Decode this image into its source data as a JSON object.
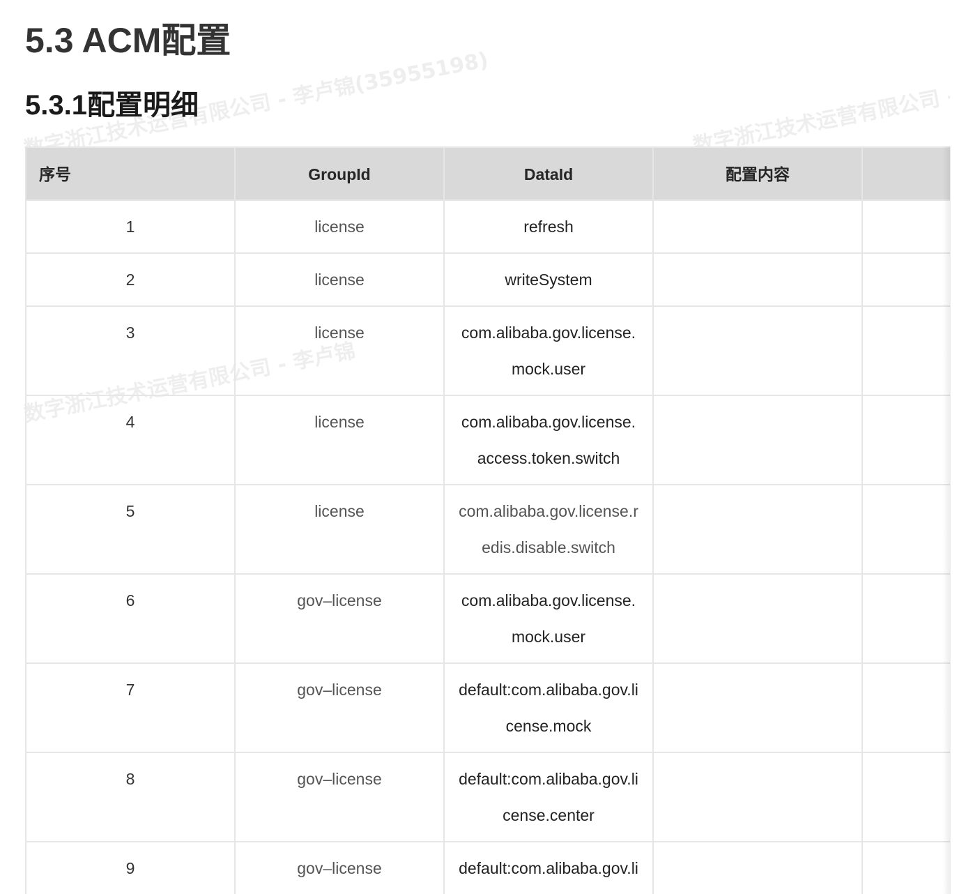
{
  "heading": "5.3 ACM配置",
  "subheading": "5.3.1配置明细",
  "watermark": {
    "line1": "数字浙江技术运营有限公司 - 李卢锦(35955198)",
    "line2": "数字浙江技术运营有限公司 - 李卢锦",
    "line3": "数字浙江技术运营有限公司 - 李卢锦",
    "side": "卢锦"
  },
  "table": {
    "headers": [
      "序号",
      "GroupId",
      "DataId",
      "配置内容",
      ""
    ],
    "rows": [
      {
        "no": "1",
        "group": "license",
        "data": "refresh",
        "content": ""
      },
      {
        "no": "2",
        "group": "license",
        "data": "writeSystem",
        "content": ""
      },
      {
        "no": "3",
        "group": "license",
        "data": "com.alibaba.gov.license.mock.user",
        "content": ""
      },
      {
        "no": "4",
        "group": "license",
        "data": "com.alibaba.gov.license.access.token.switch",
        "content": ""
      },
      {
        "no": "5",
        "group": "license",
        "data": "com.alibaba.gov.license.redis.disable.switch",
        "content": ""
      },
      {
        "no": "6",
        "group": "gov–license",
        "data": "com.alibaba.gov.license.mock.user",
        "content": ""
      },
      {
        "no": "7",
        "group": "gov–license",
        "data": "default:com.alibaba.gov.license.mock",
        "content": ""
      },
      {
        "no": "8",
        "group": "gov–license",
        "data": "default:com.alibaba.gov.license.center",
        "content": ""
      },
      {
        "no": "9",
        "group": "gov–license",
        "data": "default:com.alibaba.gov.license.bops",
        "content": ""
      }
    ]
  }
}
